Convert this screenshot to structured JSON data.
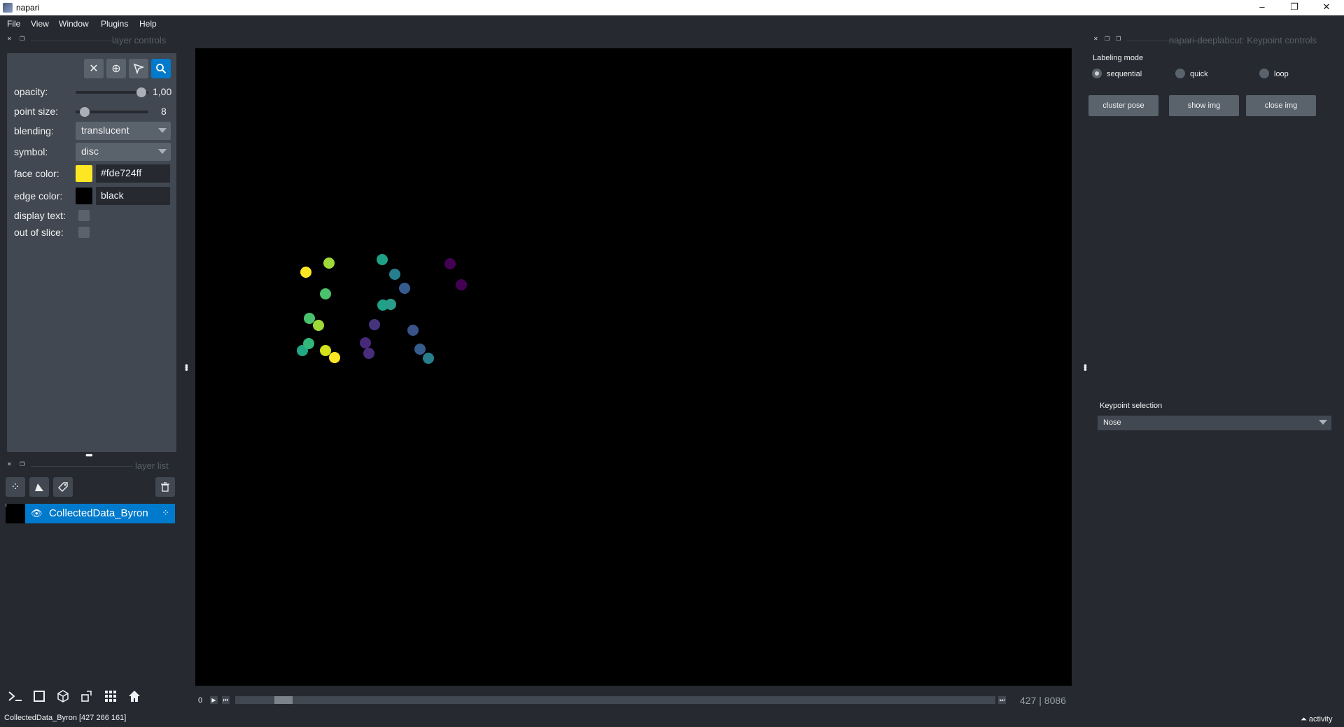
{
  "window": {
    "title": "napari",
    "minimize": "–",
    "restore": "❐",
    "close": "✕"
  },
  "menu": [
    "File",
    "View",
    "Window",
    "Plugins",
    "Help"
  ],
  "layer_controls": {
    "header": "layer controls",
    "opacity_label": "opacity:",
    "opacity_value": "1,00",
    "opacity_level": 1.0,
    "point_size_label": "point size:",
    "point_size_value": "8",
    "blending_label": "blending:",
    "blending_value": "translucent",
    "symbol_label": "symbol:",
    "symbol_value": "disc",
    "face_color_label": "face color:",
    "face_color_value": "#fde724ff",
    "face_color_hex": "#fde724",
    "edge_color_label": "edge color:",
    "edge_color_value": "black",
    "edge_color_hex": "#000000",
    "display_text_label": "display text:",
    "out_of_slice_label": "out of slice:",
    "tools": [
      "delete-icon",
      "add-points-icon",
      "select-points-icon",
      "pan-zoom-icon"
    ]
  },
  "layer_list": {
    "header": "layer list",
    "layer_name": "CollectedData_Byron",
    "thumb_text": "t"
  },
  "status": {
    "text": "CollectedData_Byron [427 266 161]",
    "activity": "activity"
  },
  "dims": {
    "start": "0",
    "current": "427",
    "total": "8086",
    "position_fraction": 0.0528
  },
  "plugin": {
    "header": "napari-deeplabcut: Keypoint controls",
    "labeling_mode_label": "Labeling mode",
    "modes": [
      "sequential",
      "quick",
      "loop"
    ],
    "selected_mode": "sequential",
    "buttons": [
      "cluster pose",
      "show img",
      "close img"
    ],
    "keypoint_selection_label": "Keypoint selection",
    "keypoint_value": "Nose"
  },
  "points": [
    {
      "color": "#fde724"
    },
    {
      "color": "#a0da39"
    },
    {
      "color": "#1fa187"
    },
    {
      "color": "#440154"
    },
    {
      "color": "#277f8e"
    },
    {
      "color": "#4ac16d"
    },
    {
      "color": "#365c8d"
    },
    {
      "color": "#440154"
    },
    {
      "color": "#1fa187"
    },
    {
      "color": "#2a9c8a"
    },
    {
      "color": "#4ac16d"
    },
    {
      "color": "#a0da39"
    },
    {
      "color": "#46337e"
    },
    {
      "color": "#3b528b"
    },
    {
      "color": "#22a884"
    },
    {
      "color": "#32b67a"
    },
    {
      "color": "#482878"
    },
    {
      "color": "#365c8d"
    },
    {
      "color": "#d2e21b"
    },
    {
      "color": "#472d7b"
    },
    {
      "color": "#fde724"
    },
    {
      "color": "#277f8e"
    }
  ]
}
